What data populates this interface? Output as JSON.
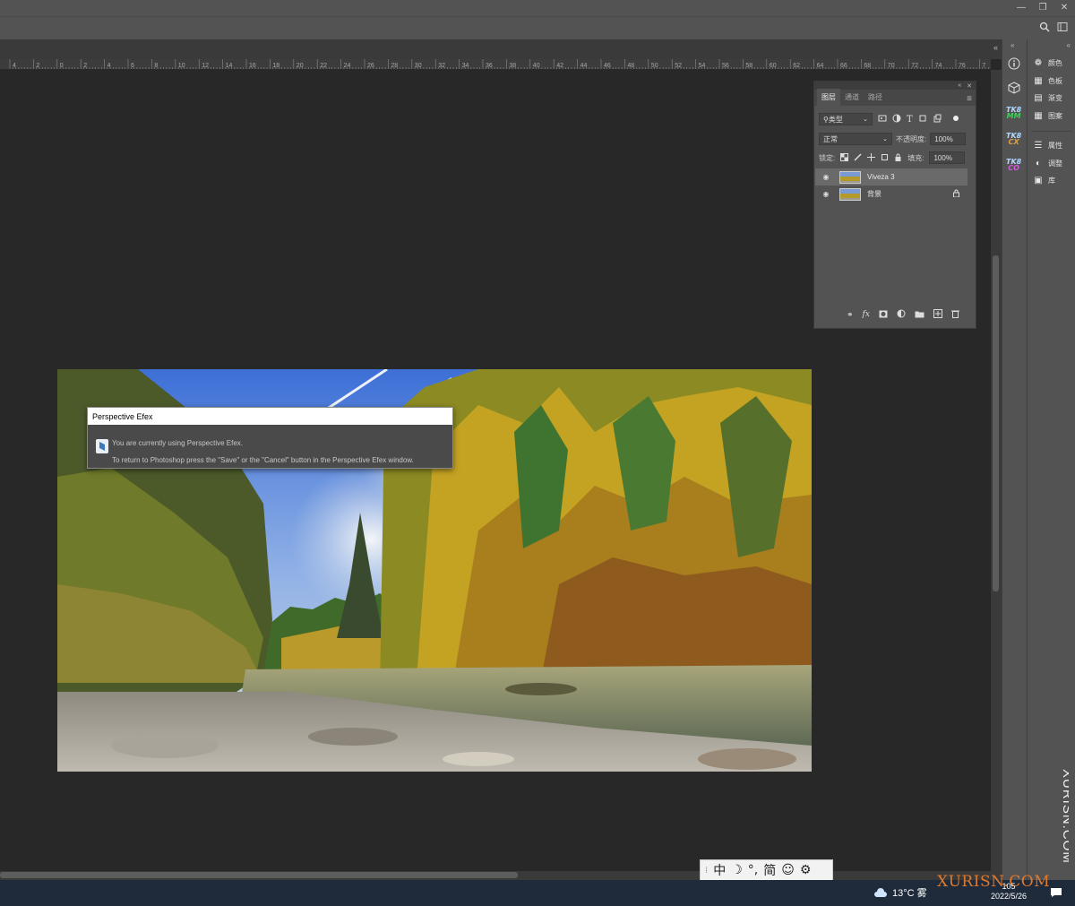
{
  "window_controls": [
    "—",
    "❐",
    "✕"
  ],
  "collapse_glyph": "«",
  "ruler": {
    "labels": [
      "4",
      "2",
      "0",
      "2",
      "4",
      "6",
      "8",
      "10",
      "12",
      "14",
      "16",
      "18",
      "20",
      "22",
      "24",
      "26",
      "28",
      "30",
      "32",
      "34",
      "36",
      "38",
      "40",
      "42",
      "44",
      "46",
      "48",
      "50",
      "52",
      "54",
      "56",
      "58",
      "60",
      "62",
      "64",
      "66",
      "68",
      "70",
      "72",
      "74",
      "76",
      "7"
    ]
  },
  "dialog": {
    "title": "Perspective Efex",
    "line1": "You are currently using Perspective Efex.",
    "line2": "To return to Photoshop press the \"Save\" or the \"Cancel\" button in the Perspective Efex window."
  },
  "layers_panel": {
    "tabs": [
      "图层",
      "通道",
      "路径"
    ],
    "filter_label": "类型",
    "blend_mode": "正常",
    "opacity_label": "不透明度:",
    "opacity_value": "100%",
    "lock_label": "锁定:",
    "fill_label": "填充:",
    "fill_value": "100%",
    "layers": [
      {
        "name": "Viveza 3",
        "selected": true,
        "locked": false
      },
      {
        "name": "背景",
        "selected": false,
        "locked": true
      }
    ],
    "footer_icons": [
      "link-icon",
      "fx-icon",
      "mask-icon",
      "adjustment-icon",
      "folder-icon",
      "new-layer-icon",
      "trash-icon"
    ]
  },
  "panel_strip": [
    {
      "label": "颜色",
      "icon": "palette-icon"
    },
    {
      "label": "色板",
      "icon": "swatches-icon"
    },
    {
      "label": "渐变",
      "icon": "gradient-icon"
    },
    {
      "label": "图案",
      "icon": "pattern-icon"
    },
    {
      "label": "属性",
      "icon": "properties-icon"
    },
    {
      "label": "调整",
      "icon": "adjust-icon"
    },
    {
      "label": "库",
      "icon": "library-icon"
    }
  ],
  "icon_strip": {
    "tk_labels": [
      {
        "top": "TK8",
        "bottom": "MM",
        "color": "#3ed15a"
      },
      {
        "top": "TK8",
        "bottom": "CX",
        "color": "#e0a040"
      },
      {
        "top": "TK8",
        "bottom": "CO",
        "color": "#d060d8"
      }
    ]
  },
  "ime": {
    "chars": [
      "中",
      "☽",
      "°,",
      "简",
      "☺",
      "⚙"
    ]
  },
  "watermark": {
    "vertical": "XURISN.COM",
    "bottom": "XURISN.COM"
  },
  "taskbar": {
    "weather": "13°C 雾",
    "clock_time": "105",
    "clock_date": "2022/5/26"
  },
  "colors": {
    "ui_bg": "#535353",
    "canvas_bg": "#282828",
    "taskbar": "#1f2b3a",
    "watermark_orange": "#e0792c"
  }
}
